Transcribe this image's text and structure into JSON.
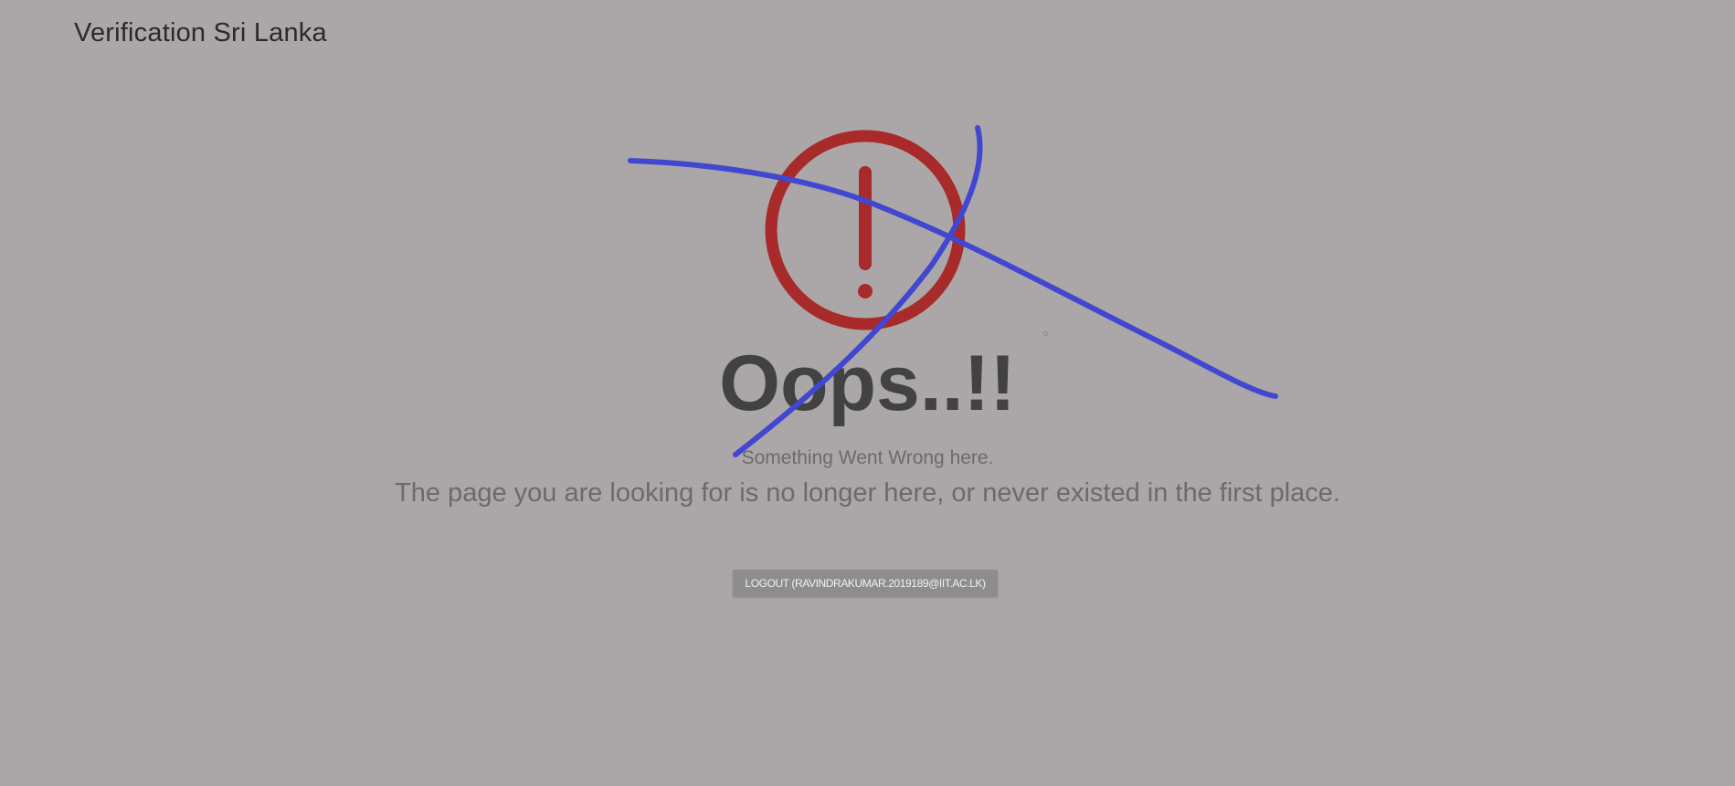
{
  "header": {
    "title": "Verification Sri Lanka"
  },
  "error": {
    "icon": "exclamation-circle-icon",
    "heading": "Oops..!!",
    "subtitle": "Something Went Wrong here.",
    "message": "The page you are looking for is no longer here, or never existed in the first place."
  },
  "actions": {
    "logout_label": "LOGOUT (RAVINDRAKUMAR.2019189@IIT.AC.LK)"
  },
  "annotation": {
    "icon": "pen-scribble",
    "color": "#4147d0"
  },
  "colors": {
    "background": "#aba7a8",
    "error_icon": "#a82a2a",
    "heading": "#424242",
    "button": "#8d8d8d"
  }
}
